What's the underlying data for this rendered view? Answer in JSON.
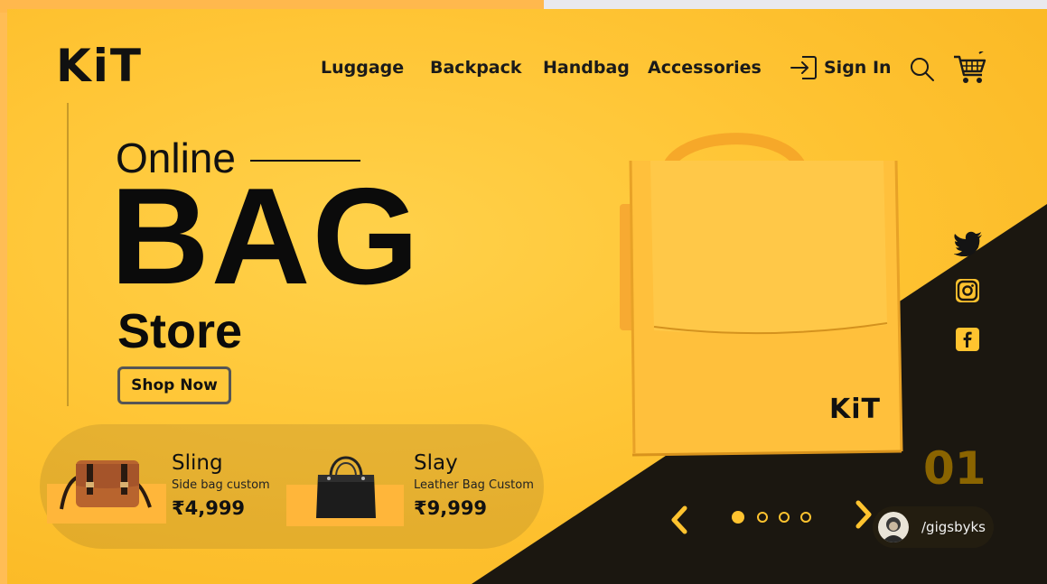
{
  "brand": {
    "logo": "KiT"
  },
  "nav": {
    "items": [
      "Luggage",
      "Backpack",
      "Handbag",
      "Accessories"
    ],
    "sign_in": "Sign In"
  },
  "hero": {
    "line1": "Online",
    "line2": "BAG",
    "line3": "Store",
    "cta": "Shop Now"
  },
  "products": [
    {
      "name": "Sling",
      "desc": "Side bag custom",
      "price": "₹4,999"
    },
    {
      "name": "Slay",
      "desc": "Leather Bag Custom",
      "price": "₹9,999"
    }
  ],
  "featured": {
    "bag_logo": "KiT",
    "slide_number": "01"
  },
  "carousel": {
    "total_slides": 4,
    "active_index": 0
  },
  "credit": {
    "handle": "/gigsbyks"
  },
  "icons": [
    "sign-in-icon",
    "search-icon",
    "cart-icon",
    "twitter-icon",
    "instagram-icon",
    "facebook-icon",
    "chevron-left-icon",
    "chevron-right-icon"
  ],
  "colors": {
    "accent": "#ffc32f",
    "dark": "#1b1710",
    "text": "#111111"
  }
}
